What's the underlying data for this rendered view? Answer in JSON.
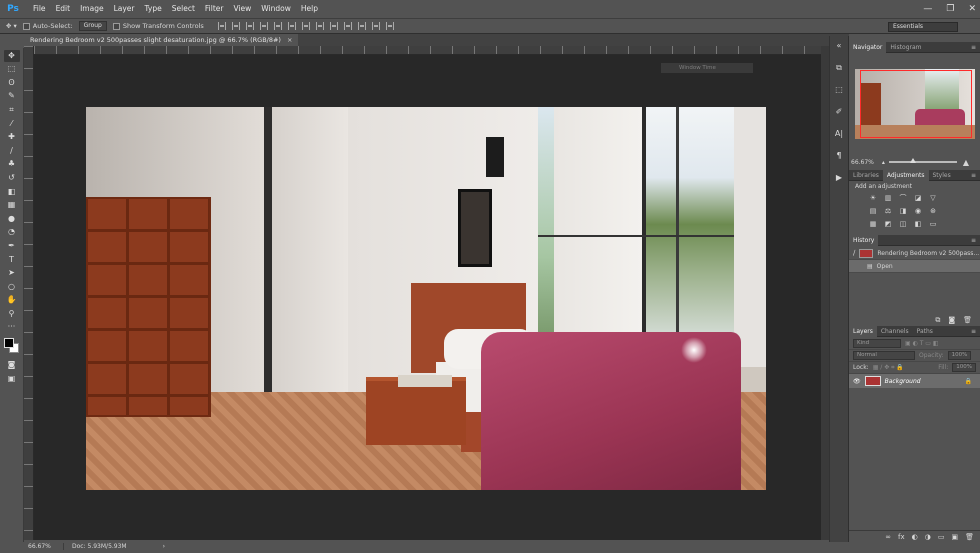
{
  "app": {
    "logo": "Ps"
  },
  "menu": [
    "File",
    "Edit",
    "Image",
    "Layer",
    "Type",
    "Select",
    "Filter",
    "View",
    "Window",
    "Help"
  ],
  "window_controls": {
    "minimize": "—",
    "restore": "❐",
    "close": "✕"
  },
  "options": {
    "auto_select_label": "Auto-Select:",
    "auto_select_value": "Group",
    "transform_label": "Show Transform Controls",
    "workspace": "Essentials"
  },
  "document": {
    "tab_title": "Rendering Bedroom v2 500passes slight desaturation.jpg @ 66.7% (RGB/8#)",
    "tab_close": "×",
    "floating_label": "Window Time"
  },
  "status": {
    "zoom": "66.67%",
    "doc": "Doc: 5.93M/5.93M",
    "arrow": "›"
  },
  "navigator": {
    "tabs": [
      "Navigator",
      "Histogram"
    ],
    "zoom": "66.67%",
    "zoom_fraction": 0.35
  },
  "adjustments": {
    "tabs": [
      "Libraries",
      "Adjustments",
      "Styles"
    ],
    "subtitle": "Add an adjustment"
  },
  "history": {
    "title": "History",
    "snapshot": "Rendering Bedroom v2 500pass...",
    "steps": [
      "Open"
    ]
  },
  "layers": {
    "tabs": [
      "Layers",
      "Channels",
      "Paths"
    ],
    "kind": "Kind",
    "blend": "Normal",
    "opacity_label": "Opacity:",
    "opacity": "100%",
    "lock_label": "Lock:",
    "fill_label": "Fill:",
    "fill": "100%",
    "layer_name": "Background",
    "bottom_icons": [
      "∞",
      "fx",
      "◐",
      "◑",
      "▭",
      "▣",
      "🗑"
    ]
  },
  "colors": {
    "accent": "#31a8ff",
    "nav_view": "#ff2a2a"
  }
}
